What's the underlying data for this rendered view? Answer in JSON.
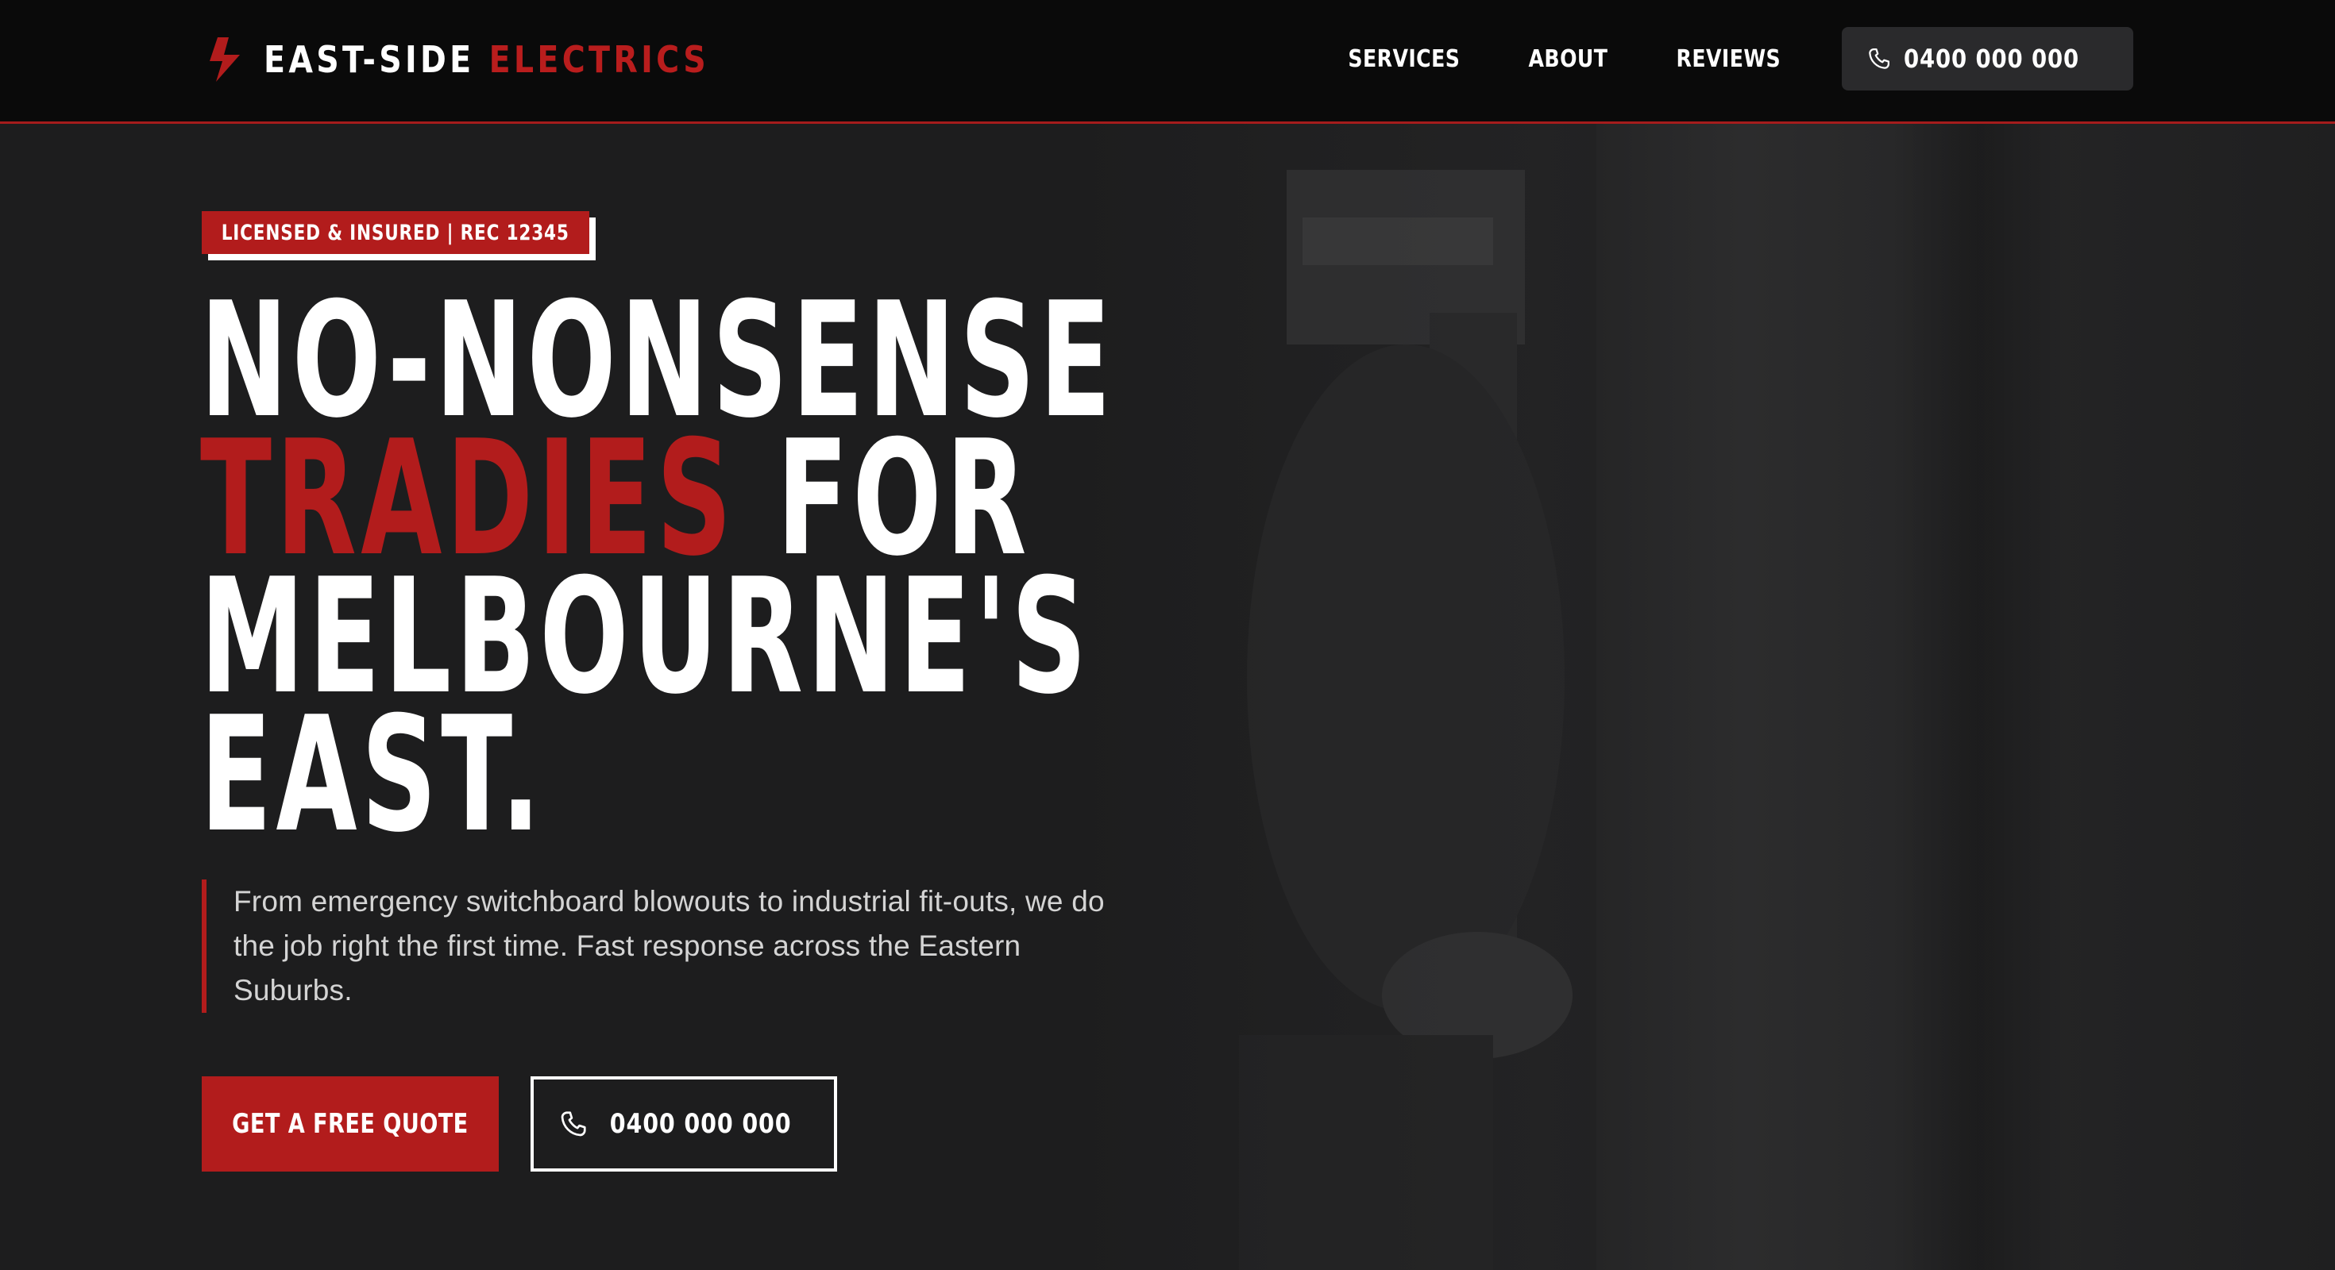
{
  "colors": {
    "accent": "#b21c1c",
    "header_bg": "#0a0a0a",
    "page_bg": "#1c1c1d",
    "text": "#ffffff",
    "muted_text": "#d4d4d4"
  },
  "header": {
    "logo": {
      "icon": "lightning-bolt-icon",
      "name_part1": "EAST-SIDE",
      "name_part2": "ELECTRICS"
    },
    "nav": {
      "items": [
        "SERVICES",
        "ABOUT",
        "REVIEWS"
      ],
      "call_icon": "phone-icon",
      "call_label": "0400 000 000"
    }
  },
  "hero": {
    "badge": "LICENSED & INSURED | REC 12345",
    "headline": {
      "line1": "NO-NONSENSE",
      "line2_accent": "TRADIES",
      "line2_rest": " FOR",
      "line3": "MELBOURNE'S",
      "line4": "EAST."
    },
    "lead": "From emergency switchboard blowouts to industrial fit-outs, we do the job right the first time. Fast response across the Eastern Suburbs.",
    "primary_cta": "GET A FREE QUOTE",
    "secondary_cta": {
      "icon": "phone-icon",
      "label": "0400 000 000"
    }
  }
}
